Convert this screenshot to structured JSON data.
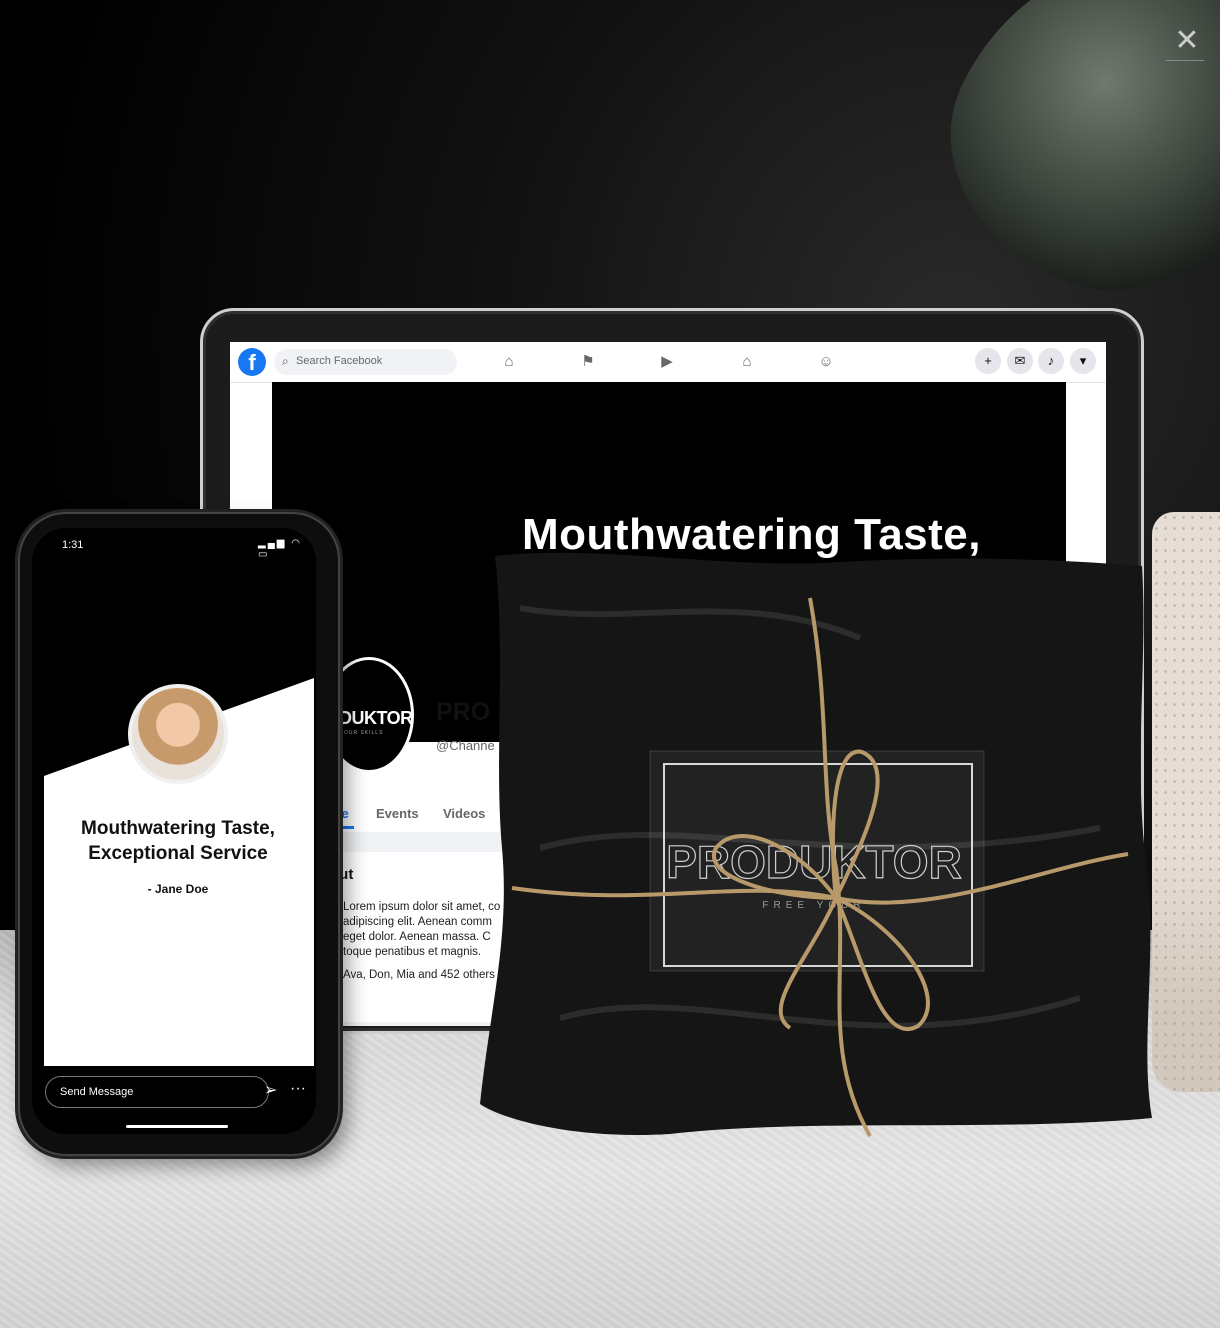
{
  "window": {
    "close_glyph": "✕"
  },
  "tablet": {
    "fb_logo": "f",
    "search": {
      "placeholder": "Search Facebook"
    },
    "nav_icons": [
      "home-icon",
      "flag-icon",
      "video-icon",
      "marketplace-icon",
      "groups-icon"
    ],
    "right_icons": [
      "plus-icon",
      "messenger-icon",
      "bell-icon",
      "caret-down-icon"
    ],
    "cover_headline": "Mouthwatering Taste,",
    "profile_logo": "DUKTOR",
    "profile_sub": "E YOUR SKILLS",
    "page_name": "PRO",
    "page_handle": "@Channe",
    "tabs": {
      "active": "me",
      "events": "Events",
      "videos": "Videos"
    },
    "about": {
      "title": "out",
      "text": "Lorem ipsum dolor sit amet, co adipiscing elit. Aenean comm eget dolor. Aenean massa. C toque penatibus et magnis.",
      "likes": "Ava, Don, Mia and 452 others"
    }
  },
  "package": {
    "label": "PRODUKTOR",
    "sublabel": "FREE YOUR"
  },
  "phone": {
    "status_time": "1:31",
    "status_icons": "▂▄▆ ◠ ▭",
    "story_title": "Mouthwatering Taste, Exceptional Service",
    "story_author": "- Jane Doe",
    "message_placeholder": "Send Message",
    "send_glyph": "➢",
    "more_glyph": "···"
  }
}
